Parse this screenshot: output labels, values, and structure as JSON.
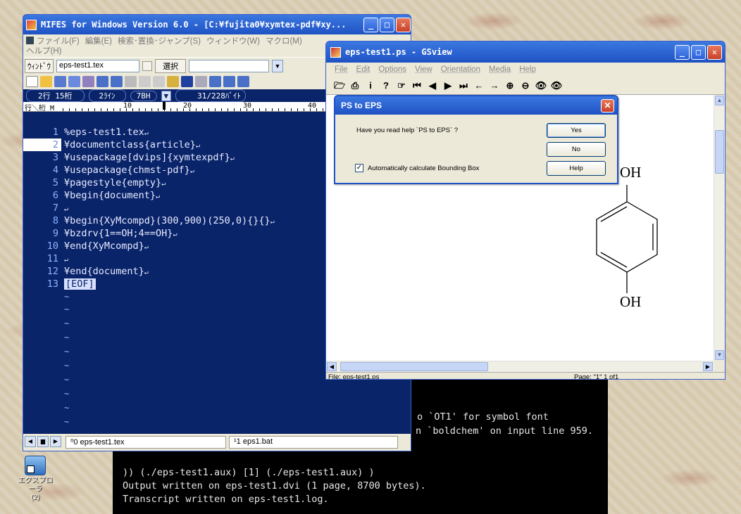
{
  "desktop": {
    "icon_label": "エクスプローラ",
    "icon_sub": "(2)"
  },
  "console": {
    "lines": [
      "o `OT1' for symbol font",
      "n `boldchem' on input line 959.",
      ")) (./eps-test1.aux) [1] (./eps-test1.aux) )",
      "Output written on eps-test1.dvi (1 page, 8700 bytes).",
      "Transcript written on eps-test1.log."
    ]
  },
  "mifes": {
    "title": "MIFES for Windows Version 6.0 - [C:¥fujita0¥xymtex-pdf¥xy...",
    "menu": [
      "ファイル(F)",
      "編集(E)",
      "検索･置換･ジャンプ(S)",
      "ウィンドウ(W)",
      "マクロ(M)"
    ],
    "menu_help": "ヘルプ(H)",
    "window_label": "ｳｨﾝﾄﾞｳ",
    "window_value": "eps-test1.tex",
    "select_label": "選択",
    "status": [
      "2行  15桁",
      "2ﾗｲﾝ",
      "7BH",
      "31/228ﾊﾞｲﾄ"
    ],
    "ruler_label": "行＼桁 M",
    "ruler_marks": [
      "10",
      "20",
      "30",
      "40"
    ],
    "lines": [
      {
        "num": "1",
        "text": "%eps-test1.tex"
      },
      {
        "num": "2",
        "text": "¥documentclass{article}"
      },
      {
        "num": "3",
        "text": "¥usepackage[dvips]{xymtexpdf}"
      },
      {
        "num": "4",
        "text": "¥usepackage{chmst-pdf}"
      },
      {
        "num": "5",
        "text": "¥pagestyle{empty}"
      },
      {
        "num": "6",
        "text": "¥begin{document}"
      },
      {
        "num": "7",
        "text": ""
      },
      {
        "num": "8",
        "text": "¥begin{XyMcompd}(300,900)(250,0){}{}"
      },
      {
        "num": "9",
        "text": "¥bzdrv{1==OH;4==OH}"
      },
      {
        "num": "10",
        "text": "¥end{XyMcompd}"
      },
      {
        "num": "11",
        "text": ""
      },
      {
        "num": "12",
        "text": "¥end{document}"
      },
      {
        "num": "13",
        "text": "[EOF]"
      }
    ],
    "tabs": [
      "⁰0 eps-test1.tex",
      "¹1 eps1.bat"
    ]
  },
  "gsview": {
    "title": "eps-test1.ps - GSview",
    "menu": [
      "File",
      "Edit",
      "Options",
      "View",
      "Orientation",
      "Media",
      "Help"
    ],
    "status_file": "File: eps-test1.ps",
    "status_page": "Page: \"1\"  1 of1",
    "molecule_top": "OH",
    "molecule_bottom": "OH"
  },
  "dialog": {
    "title": "PS to EPS",
    "question": "Have you read help `PS to EPS` ?",
    "yes": "Yes",
    "no": "No",
    "help": "Help",
    "checkbox_label": "Automatically calculate Bounding Box",
    "checkbox_checked": true
  }
}
